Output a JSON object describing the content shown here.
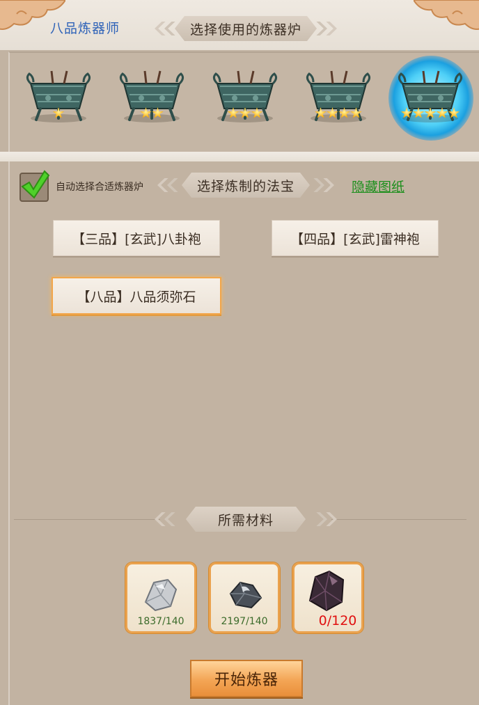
{
  "header": {
    "rank_title": "八品炼器师",
    "furnace_section_title": "选择使用的炼器炉"
  },
  "furnaces": [
    {
      "stars": 1,
      "selected": false,
      "icon": "bronze-furnace-icon"
    },
    {
      "stars": 2,
      "selected": false,
      "icon": "bronze-furnace-icon"
    },
    {
      "stars": 3,
      "selected": false,
      "icon": "bronze-furnace-icon"
    },
    {
      "stars": 4,
      "selected": false,
      "icon": "bronze-furnace-icon"
    },
    {
      "stars": 5,
      "selected": true,
      "icon": "bronze-furnace-icon"
    }
  ],
  "recipe_section": {
    "auto_select_label": "自动选择合适炼器炉",
    "auto_select_checked": true,
    "title": "选择炼制的法宝",
    "hide_blueprint_label": "隐藏图纸",
    "recipes": [
      {
        "label": "【三品】[玄武]八卦袍",
        "selected": false
      },
      {
        "label": "【四品】[玄武]雷神袍",
        "selected": false
      },
      {
        "label": "【八品】八品须弥石",
        "selected": true
      }
    ]
  },
  "materials_section": {
    "title": "所需材料",
    "items": [
      {
        "icon": "silver-ore-icon",
        "count": "1837/140",
        "sufficient": true
      },
      {
        "icon": "dark-ore-icon",
        "count": "2197/140",
        "sufficient": true
      },
      {
        "icon": "purple-crystal-icon",
        "count": "0/120",
        "sufficient": false
      }
    ]
  },
  "start_button_label": "开始炼器",
  "colors": {
    "rank_title": "#2f63b8",
    "hide_link": "#1d8f1d",
    "lack_count": "#e01010",
    "enough_count": "#3b6b2a",
    "accent": "#f3a555"
  }
}
